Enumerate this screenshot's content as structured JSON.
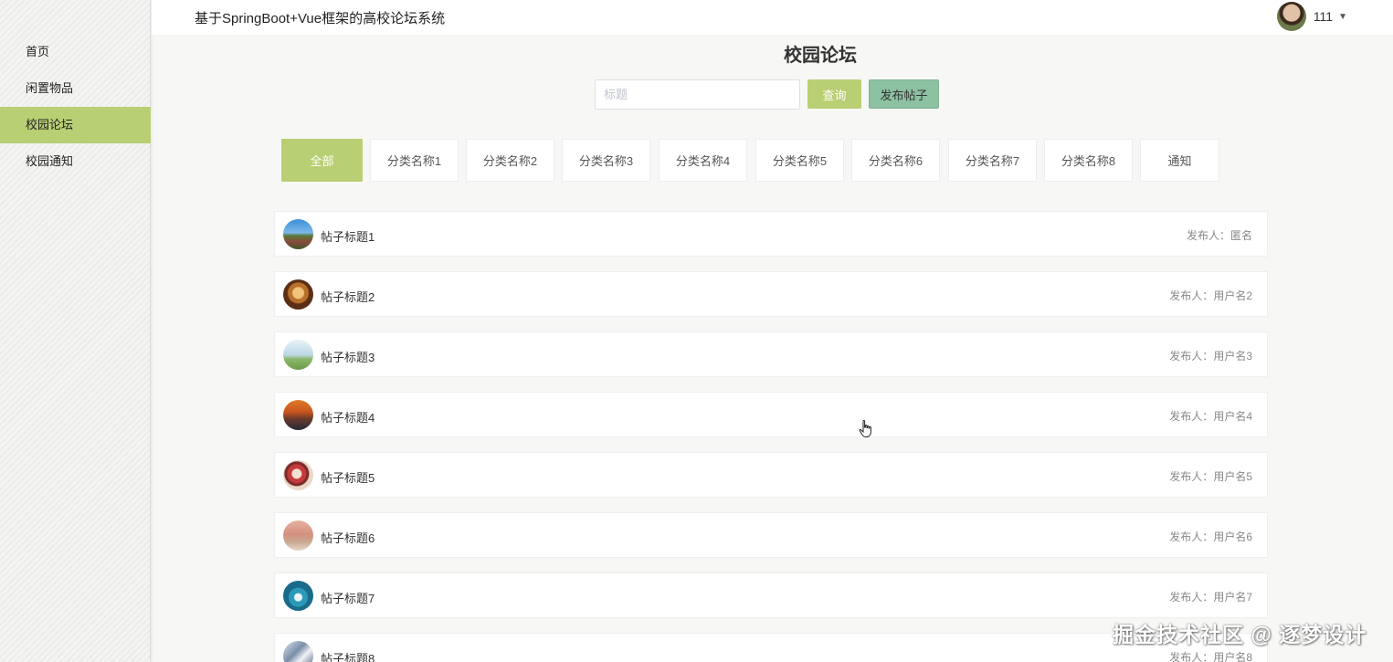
{
  "sidebar": {
    "items": [
      {
        "label": "首页",
        "active": false
      },
      {
        "label": "闲置物品",
        "active": false
      },
      {
        "label": "校园论坛",
        "active": true
      },
      {
        "label": "校园通知",
        "active": false
      }
    ]
  },
  "header": {
    "site_title": "基于SpringBoot+Vue框架的高校论坛系统",
    "user_name": "111",
    "caret": "▼"
  },
  "main": {
    "page_title": "校园论坛",
    "search": {
      "placeholder": "标题",
      "value": ""
    },
    "query_label": "查询",
    "post_label": "发布帖子",
    "tabs": [
      {
        "label": "全部",
        "active": true
      },
      {
        "label": "分类名称1"
      },
      {
        "label": "分类名称2"
      },
      {
        "label": "分类名称3"
      },
      {
        "label": "分类名称4"
      },
      {
        "label": "分类名称5"
      },
      {
        "label": "分类名称6"
      },
      {
        "label": "分类名称7"
      },
      {
        "label": "分类名称8"
      },
      {
        "label": "通知"
      }
    ],
    "author_prefix": "发布人：",
    "posts": [
      {
        "title": "帖子标题1",
        "author": "匿名"
      },
      {
        "title": "帖子标题2",
        "author": "用户名2"
      },
      {
        "title": "帖子标题3",
        "author": "用户名3"
      },
      {
        "title": "帖子标题4",
        "author": "用户名4"
      },
      {
        "title": "帖子标题5",
        "author": "用户名5"
      },
      {
        "title": "帖子标题6",
        "author": "用户名6"
      },
      {
        "title": "帖子标题7",
        "author": "用户名7"
      },
      {
        "title": "帖子标题8",
        "author": "用户名8"
      }
    ]
  },
  "colors": {
    "accent": "#b9cf73",
    "post_button": "#8cc1a1"
  },
  "watermark": "掘金技术社区 @ 逐梦设计"
}
